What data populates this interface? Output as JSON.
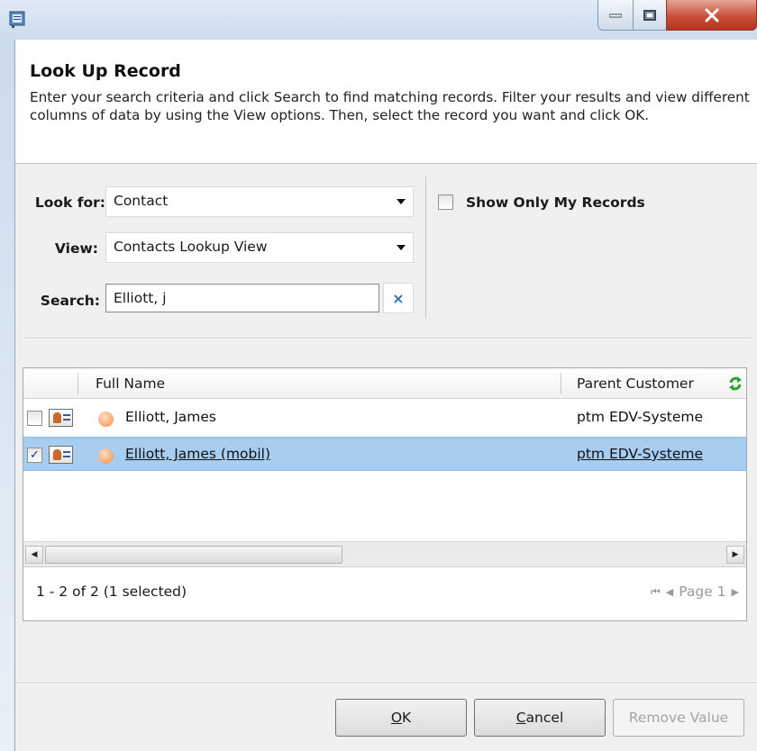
{
  "window": {
    "minimize_glyph": "–",
    "maximize_glyph": "□",
    "close_glyph": "X"
  },
  "header": {
    "title": "Look Up Record",
    "instructions": "Enter your search criteria and click Search to find matching records. Filter your results and view different columns of data by using the View options. Then, select the record you want and click OK."
  },
  "filters": {
    "look_for_label": "Look for:",
    "look_for_value": "Contact",
    "view_label": "View:",
    "view_value": "Contacts Lookup View",
    "search_label": "Search:",
    "search_value": "Elliott, j",
    "clear_glyph": "×",
    "show_only_my_records_label": "Show Only My Records",
    "show_only_my_records_checked": false
  },
  "grid": {
    "columns": [
      "Full Name",
      "Parent Customer"
    ],
    "rows": [
      {
        "full_name": "Elliott, James",
        "parent_customer": "ptm EDV-Systeme",
        "checked": false,
        "check_glyph": ""
      },
      {
        "full_name": "Elliott, James (mobil)",
        "parent_customer": "ptm EDV-Systeme",
        "checked": true,
        "check_glyph": "✓"
      }
    ],
    "status": "1 - 2 of 2 (1 selected)",
    "page_label": "Page 1",
    "scroll_left_glyph": "◀",
    "scroll_right_glyph": "▶",
    "first_page_glyph": "⏮",
    "prev_page_glyph": "◀",
    "next_page_glyph": "▶"
  },
  "buttons": {
    "ok_accel": "O",
    "ok_rest": "K",
    "cancel_accel": "C",
    "cancel_rest": "ancel",
    "remove_value": "Remove Value"
  },
  "colors": {
    "selected_row": "#a7cdf0",
    "refresh_icon": "#2aa52a",
    "close_button": "#c9503b"
  }
}
